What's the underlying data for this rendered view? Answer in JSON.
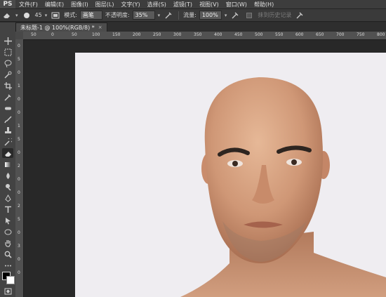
{
  "app": {
    "logo": "PS"
  },
  "menu": {
    "items": [
      "文件(F)",
      "编辑(E)",
      "图像(I)",
      "图层(L)",
      "文字(Y)",
      "选择(S)",
      "滤镜(T)",
      "视图(V)",
      "窗口(W)",
      "帮助(H)"
    ]
  },
  "options": {
    "brush_size": "45",
    "mode_label": "模式:",
    "mode_value": "画笔",
    "opacity_label": "不透明度:",
    "opacity_value": "35%",
    "flow_label": "流量:",
    "flow_value": "100%",
    "history_label": "抹到历史记录"
  },
  "document": {
    "tab_title": "未标题-1 @ 100%(RGB/8) *",
    "close_glyph": "×"
  },
  "rulers": {
    "top": [
      "50",
      "0",
      "50",
      "100",
      "150",
      "200",
      "250",
      "300",
      "350",
      "400",
      "450",
      "500",
      "550",
      "600",
      "650",
      "700",
      "750",
      "800"
    ],
    "left": [
      "0",
      "5",
      "0",
      "1",
      "0",
      "0",
      "1",
      "5",
      "0",
      "2",
      "0",
      "0",
      "2",
      "5",
      "0",
      "3",
      "0",
      "0"
    ]
  },
  "colors": {
    "canvas_bg": "#efedf1",
    "skin": "#d7a17e",
    "ui_dark": "#2b2b2b"
  },
  "icons": {
    "tools": [
      "move-icon",
      "marquee-icon",
      "lasso-icon",
      "quick-select-icon",
      "crop-icon",
      "eyedropper-icon",
      "healing-icon",
      "brush-icon",
      "stamp-icon",
      "history-brush-icon",
      "eraser-icon",
      "gradient-icon",
      "blur-icon",
      "dodge-icon",
      "pen-icon",
      "type-icon",
      "path-select-icon",
      "shape-icon",
      "hand-icon",
      "zoom-icon"
    ]
  }
}
